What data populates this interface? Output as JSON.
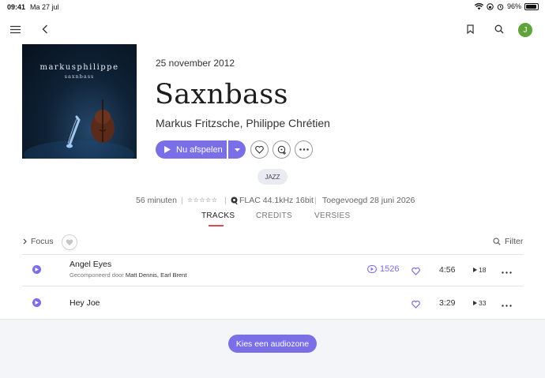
{
  "status": {
    "time": "09:41",
    "date": "Ma 27 jul",
    "battery": "96%",
    "battery_level": 0.96,
    "icons": [
      "wifi-icon",
      "lock-rotation-icon",
      "alarm-icon"
    ]
  },
  "nav": {
    "avatar_initial": "J",
    "icons": [
      "menu-icon",
      "back-icon",
      "bookmark-icon",
      "search-icon"
    ]
  },
  "album": {
    "cover_artist": "markusphilippe",
    "cover_title": "saxnbass",
    "release_date": "25 november 2012",
    "title": "Saxnbass",
    "artists": "Markus Fritzsche, Philippe Chrétien",
    "play_label": "Nu afspelen",
    "genre_tag": "JAZZ"
  },
  "meta": {
    "duration": "56 minuten",
    "rating_stars": "☆☆☆☆☆",
    "format": "FLAC 44.1kHz 16bit",
    "added": "Toegevoegd 28 juni 2026"
  },
  "tabs": [
    {
      "label": "TRACKS",
      "active": true
    },
    {
      "label": "CREDITS",
      "active": false
    },
    {
      "label": "VERSIES",
      "active": false
    }
  ],
  "list_controls": {
    "focus_label": "Focus",
    "filter_label": "Filter"
  },
  "tracks": [
    {
      "title": "Angel Eyes",
      "composer_prefix": "Gecomponeerd door",
      "composers": "Matt Dennis, Earl Brent",
      "plays": "1526",
      "duration": "4:56",
      "play_count": "18"
    },
    {
      "title": "Hey Joe",
      "composer_prefix": "",
      "composers": "",
      "plays": "",
      "duration": "3:29",
      "play_count": "33"
    }
  ],
  "footer": {
    "zone_button": "Kies een audiozone"
  },
  "colors": {
    "accent": "#7b6fe8",
    "tab_underline": "#e5484d",
    "avatar": "#5fa33a"
  }
}
